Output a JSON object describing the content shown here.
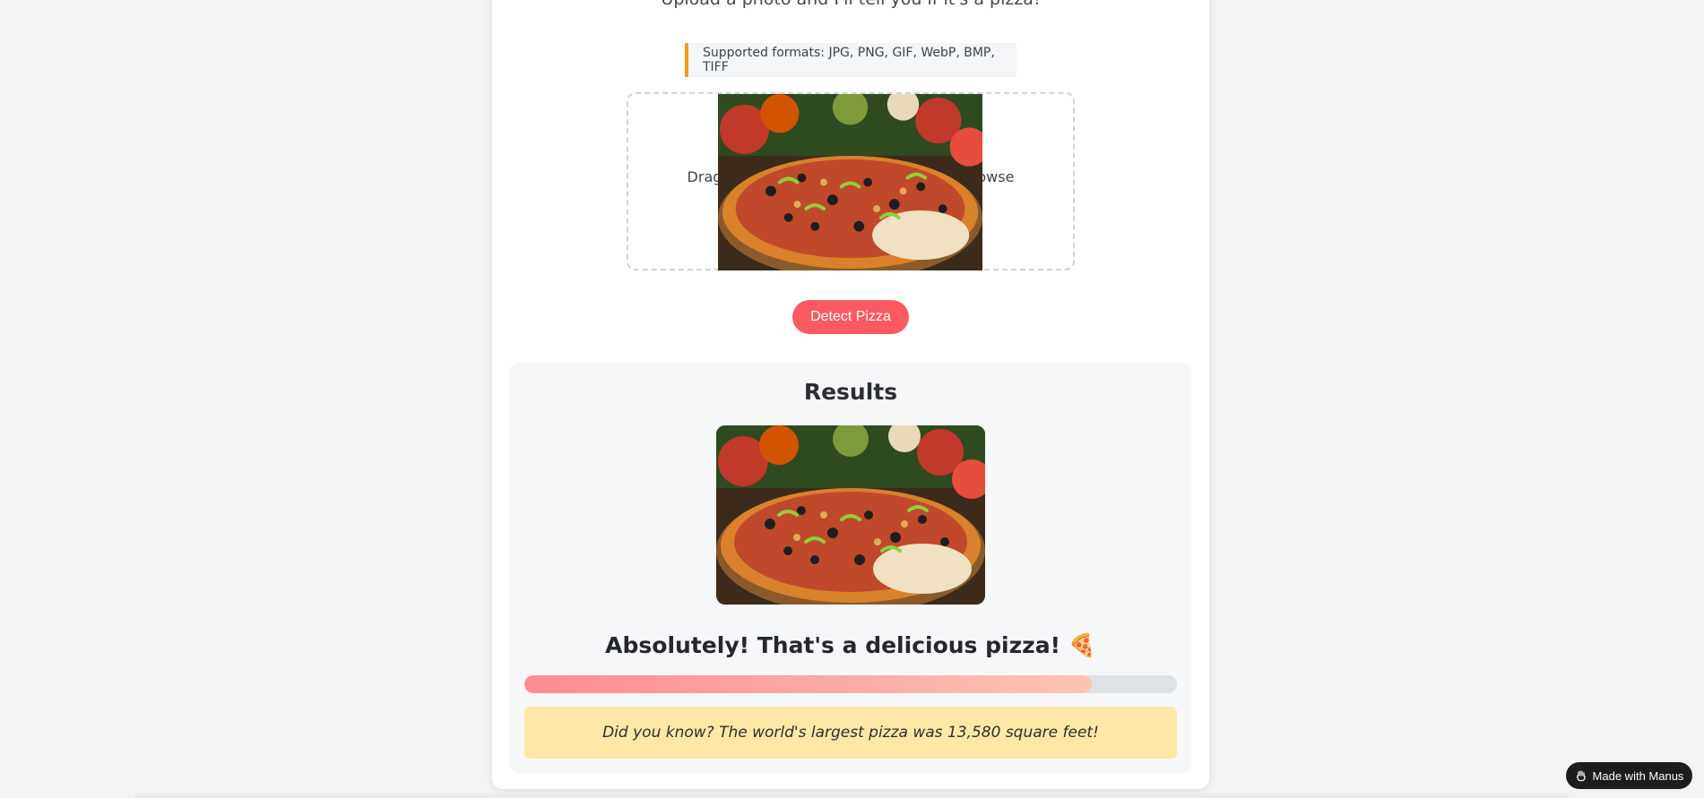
{
  "header": {
    "subtitle": "Upload a photo and I'll tell you if it's a pizza!"
  },
  "upload": {
    "formats_note": "Supported formats: JPG, PNG, GIF, WebP, BMP, TIFF",
    "dropzone_text": "Drag & drop an image here or click to browse",
    "preview_image": "pizza-photo"
  },
  "actions": {
    "detect_label": "Detect Pizza"
  },
  "results": {
    "title": "Results",
    "image": "pizza-photo",
    "verdict": "Absolutely! That's a delicious pizza! 🍕",
    "confidence_fraction": 0.87,
    "fact": "Did you know? The world's largest pizza was 13,580 square feet!"
  },
  "badge": {
    "label": "Made with Manus",
    "icon": "manus-hand-icon"
  },
  "colors": {
    "accent": "#fc5a62",
    "formats_border": "#f39c12",
    "fact_background": "#ffe8a6"
  }
}
